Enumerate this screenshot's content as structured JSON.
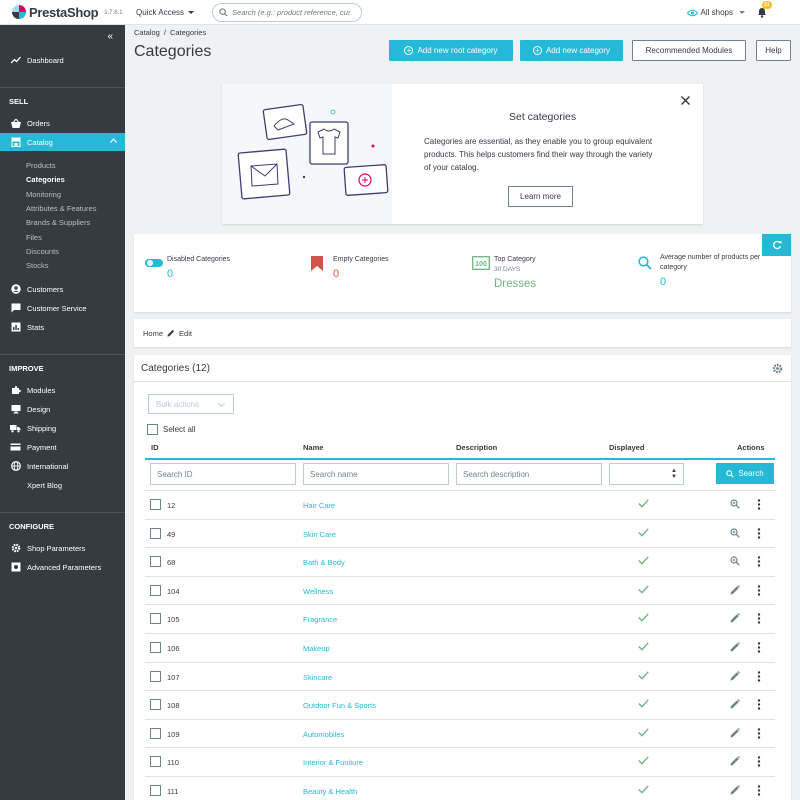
{
  "header": {
    "brand": "PrestaShop",
    "version": "1.7.6.1",
    "quick_access": "Quick Access",
    "search_placeholder": "Search (e.g.: product reference, customer",
    "shops": "All shops",
    "notifications": "31"
  },
  "sidebar": {
    "dashboard": "Dashboard",
    "sell_title": "SELL",
    "orders": "Orders",
    "catalog": "Catalog",
    "catalog_sub": [
      "Products",
      "Categories",
      "Monitoring",
      "Attributes & Features",
      "Brands & Suppliers",
      "Files",
      "Discounts",
      "Stocks"
    ],
    "customers": "Customers",
    "customer_service": "Customer Service",
    "stats": "Stats",
    "improve_title": "IMPROVE",
    "modules": "Modules",
    "design": "Design",
    "shipping": "Shipping",
    "payment": "Payment",
    "international": "International",
    "xpert_blog": "Xpert Blog",
    "configure_title": "CONFIGURE",
    "shop_parameters": "Shop Parameters",
    "advanced_parameters": "Advanced Parameters"
  },
  "page": {
    "breadcrumb": [
      "Catalog",
      "/",
      "Categories"
    ],
    "title": "Categories",
    "buttons": {
      "add_root": "Add new root category",
      "add_new": "Add new category",
      "recommended": "Recommended Modules",
      "help": "Help"
    }
  },
  "onboarding": {
    "title": "Set categories",
    "text": "Categories are essential, as they enable you to group equivalent products. This helps customers find their way through the variety of your catalog.",
    "learn_more": "Learn more"
  },
  "kpis": {
    "disabled_label": "Disabled Categories",
    "disabled_value": "0",
    "empty_label": "Empty Categories",
    "empty_value": "0",
    "top_label": "Top Category",
    "top_sub": "30 DAYS",
    "top_value": "Dresses",
    "avg_label_1": "Average number of products per",
    "avg_label_2": "category",
    "avg_value": "0",
    "colors": {
      "accent": "#25b9d7",
      "danger": "#f54c3e",
      "success": "#70b580"
    }
  },
  "crumb": {
    "home": "Home",
    "edit": "Edit"
  },
  "list": {
    "title": "Categories (12)",
    "bulk_actions": "Bulk actions",
    "select_all": "Select all",
    "columns": {
      "id": "ID",
      "name": "Name",
      "description": "Description",
      "displayed": "Displayed",
      "actions": "Actions"
    },
    "filters": {
      "id": "Search ID",
      "name": "Search name",
      "description": "Search description"
    },
    "search_btn": "Search",
    "rows": [
      {
        "id": "12",
        "name": "Hair Care",
        "action": "view"
      },
      {
        "id": "49",
        "name": "Skin Care",
        "action": "view"
      },
      {
        "id": "68",
        "name": "Bath & Body",
        "action": "view"
      },
      {
        "id": "104",
        "name": "Wellness",
        "action": "edit"
      },
      {
        "id": "105",
        "name": "Fragrance",
        "action": "edit"
      },
      {
        "id": "106",
        "name": "Makeup",
        "action": "edit"
      },
      {
        "id": "107",
        "name": "Skincare",
        "action": "edit"
      },
      {
        "id": "108",
        "name": "Outdoor Fun & Sports",
        "action": "edit"
      },
      {
        "id": "109",
        "name": "Automobiles",
        "action": "edit"
      },
      {
        "id": "110",
        "name": "Interior & Funiture",
        "action": "edit"
      },
      {
        "id": "111",
        "name": "Beauty & Health",
        "action": "edit"
      }
    ]
  }
}
